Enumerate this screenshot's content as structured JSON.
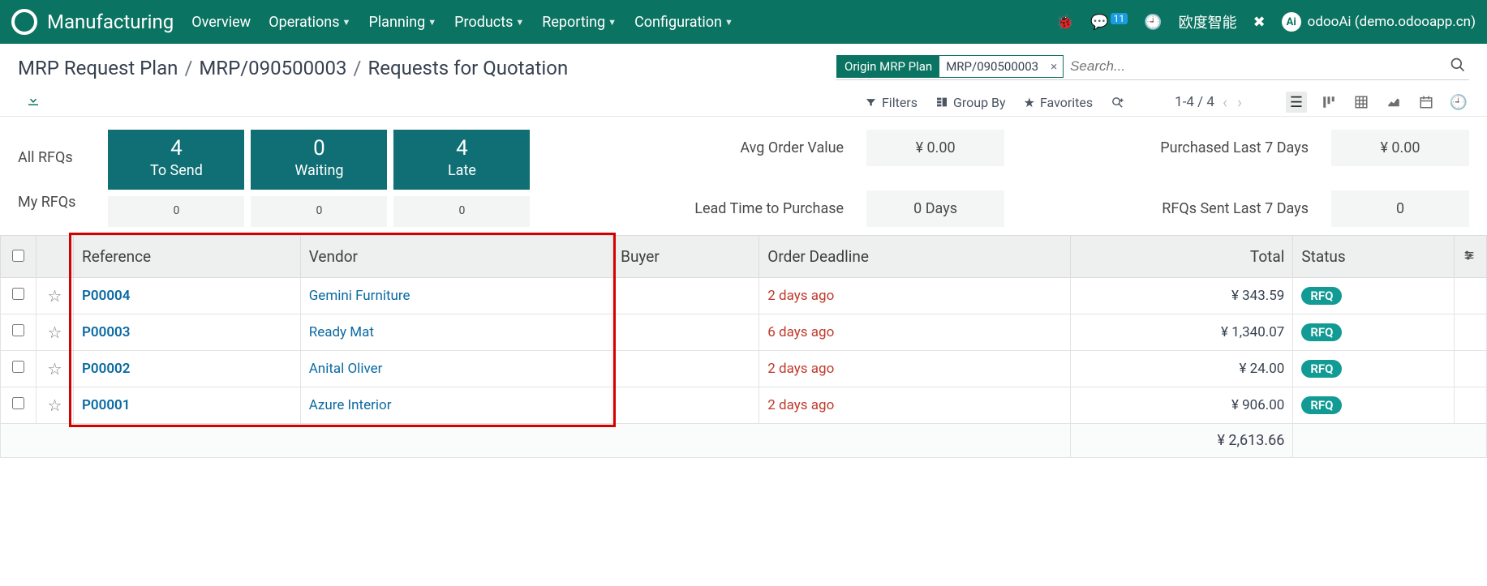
{
  "navbar": {
    "app": "Manufacturing",
    "menu": [
      "Overview",
      "Operations",
      "Planning",
      "Products",
      "Reporting",
      "Configuration"
    ],
    "menu_caret": [
      false,
      true,
      true,
      true,
      true,
      true
    ],
    "msg_count": "11",
    "cn_text": "欧度智能",
    "user": "odooAi (demo.odooapp.cn)"
  },
  "breadcrumb": {
    "a": "MRP Request Plan",
    "b": "MRP/090500003",
    "c": "Requests for Quotation"
  },
  "search": {
    "facet_label": "Origin MRP Plan",
    "facet_value": "MRP/090500003",
    "placeholder": "Search..."
  },
  "tools": {
    "filters": "Filters",
    "groupby": "Group By",
    "favorites": "Favorites",
    "pager": "1-4 / 4"
  },
  "dash": {
    "left_labels": [
      "All RFQs",
      "My RFQs"
    ],
    "tiles": [
      {
        "num": "4",
        "lbl": "To Send",
        "sub": "0"
      },
      {
        "num": "0",
        "lbl": "Waiting",
        "sub": "0"
      },
      {
        "num": "4",
        "lbl": "Late",
        "sub": "0"
      }
    ],
    "right": {
      "avg_label": "Avg Order Value",
      "avg_val": "¥ 0.00",
      "p7_label": "Purchased Last 7 Days",
      "p7_val": "¥ 0.00",
      "lead_label": "Lead Time to Purchase",
      "lead_val": "0 Days",
      "sent7_label": "RFQs Sent Last 7 Days",
      "sent7_val": "0"
    }
  },
  "table": {
    "headers": {
      "ref": "Reference",
      "ven": "Vendor",
      "buyer": "Buyer",
      "dead": "Order Deadline",
      "total": "Total",
      "status": "Status"
    },
    "rows": [
      {
        "ref": "P00004",
        "ven": "Gemini Furniture",
        "buyer": "",
        "dead": "2 days ago",
        "total": "¥ 343.59",
        "status": "RFQ"
      },
      {
        "ref": "P00003",
        "ven": "Ready Mat",
        "buyer": "",
        "dead": "6 days ago",
        "total": "¥ 1,340.07",
        "status": "RFQ"
      },
      {
        "ref": "P00002",
        "ven": "Anital Oliver",
        "buyer": "",
        "dead": "2 days ago",
        "total": "¥ 24.00",
        "status": "RFQ"
      },
      {
        "ref": "P00001",
        "ven": "Azure Interior",
        "buyer": "",
        "dead": "2 days ago",
        "total": "¥ 906.00",
        "status": "RFQ"
      }
    ],
    "grand_total": "¥ 2,613.66"
  }
}
